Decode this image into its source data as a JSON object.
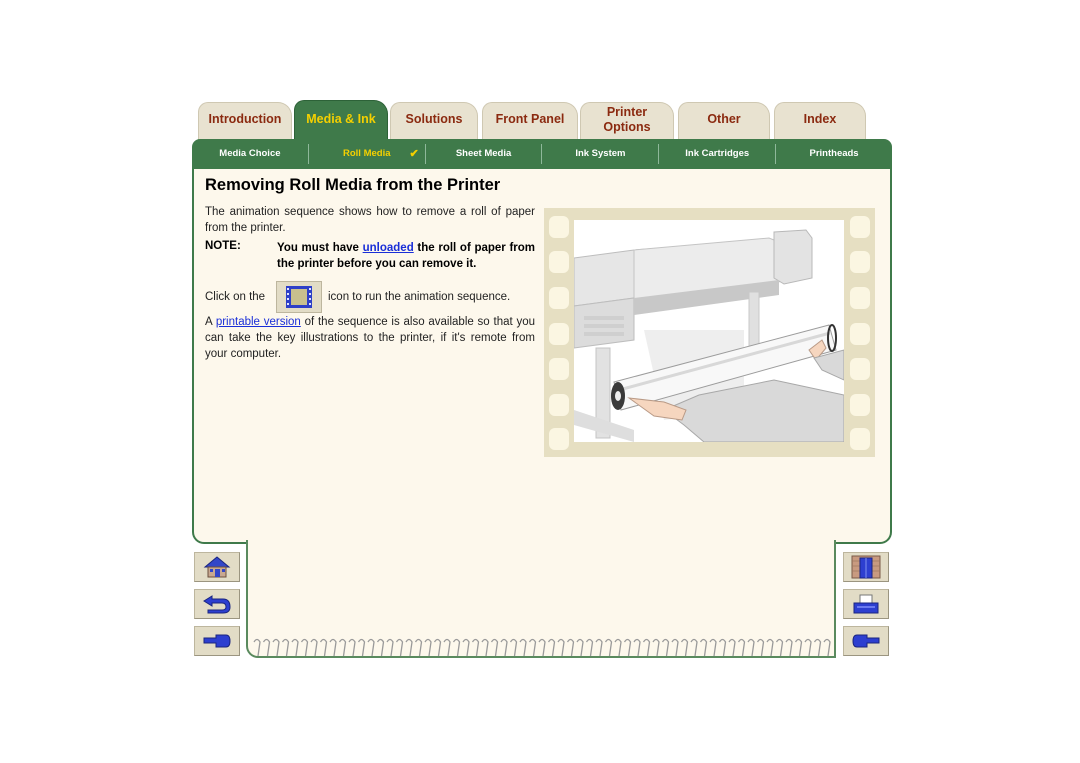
{
  "tabs": [
    {
      "label": "Introduction",
      "active": false
    },
    {
      "label": "Media & Ink",
      "active": true
    },
    {
      "label": "Solutions",
      "active": false
    },
    {
      "label": "Front Panel",
      "active": false
    },
    {
      "label": "Printer Options",
      "line1": "Printer",
      "line2": "Options",
      "active": false
    },
    {
      "label": "Other",
      "active": false
    },
    {
      "label": "Index",
      "active": false
    }
  ],
  "subnav": [
    {
      "label": "Media Choice",
      "active": false
    },
    {
      "label": "Roll Media",
      "active": true,
      "mark": "✔"
    },
    {
      "label": "Sheet Media",
      "active": false
    },
    {
      "label": "Ink System",
      "active": false
    },
    {
      "label": "Ink Cartridges",
      "active": false
    },
    {
      "label": "Printheads",
      "active": false
    }
  ],
  "page": {
    "title": "Removing Roll Media from the Printer",
    "intro": "The animation sequence shows how to remove a roll of paper from the printer.",
    "note": {
      "label": "NOTE:",
      "before": "You must have ",
      "link": "unloaded",
      "after": " the roll of paper from the printer before you can remove it."
    },
    "click": {
      "before": "Click on the",
      "after": "icon to run the animation sequence."
    },
    "printable": {
      "before": "A ",
      "link": "printable version",
      "after": " of the sequence is also available so that you can take the key illustrations to the printer, if it's remote from your computer."
    }
  },
  "colors": {
    "tab_green": "#3f7a4a",
    "active_text": "#f5d000",
    "tab_text": "#8b2a10",
    "panel_bg": "#fdf8ec",
    "link": "#1a2fd8"
  },
  "nav_left": [
    {
      "icon": "home-icon"
    },
    {
      "icon": "back-arrow-icon"
    },
    {
      "icon": "previous-page-hand-icon"
    }
  ],
  "nav_right": [
    {
      "icon": "exit-door-icon"
    },
    {
      "icon": "printer-icon"
    },
    {
      "icon": "next-page-hand-icon"
    }
  ]
}
